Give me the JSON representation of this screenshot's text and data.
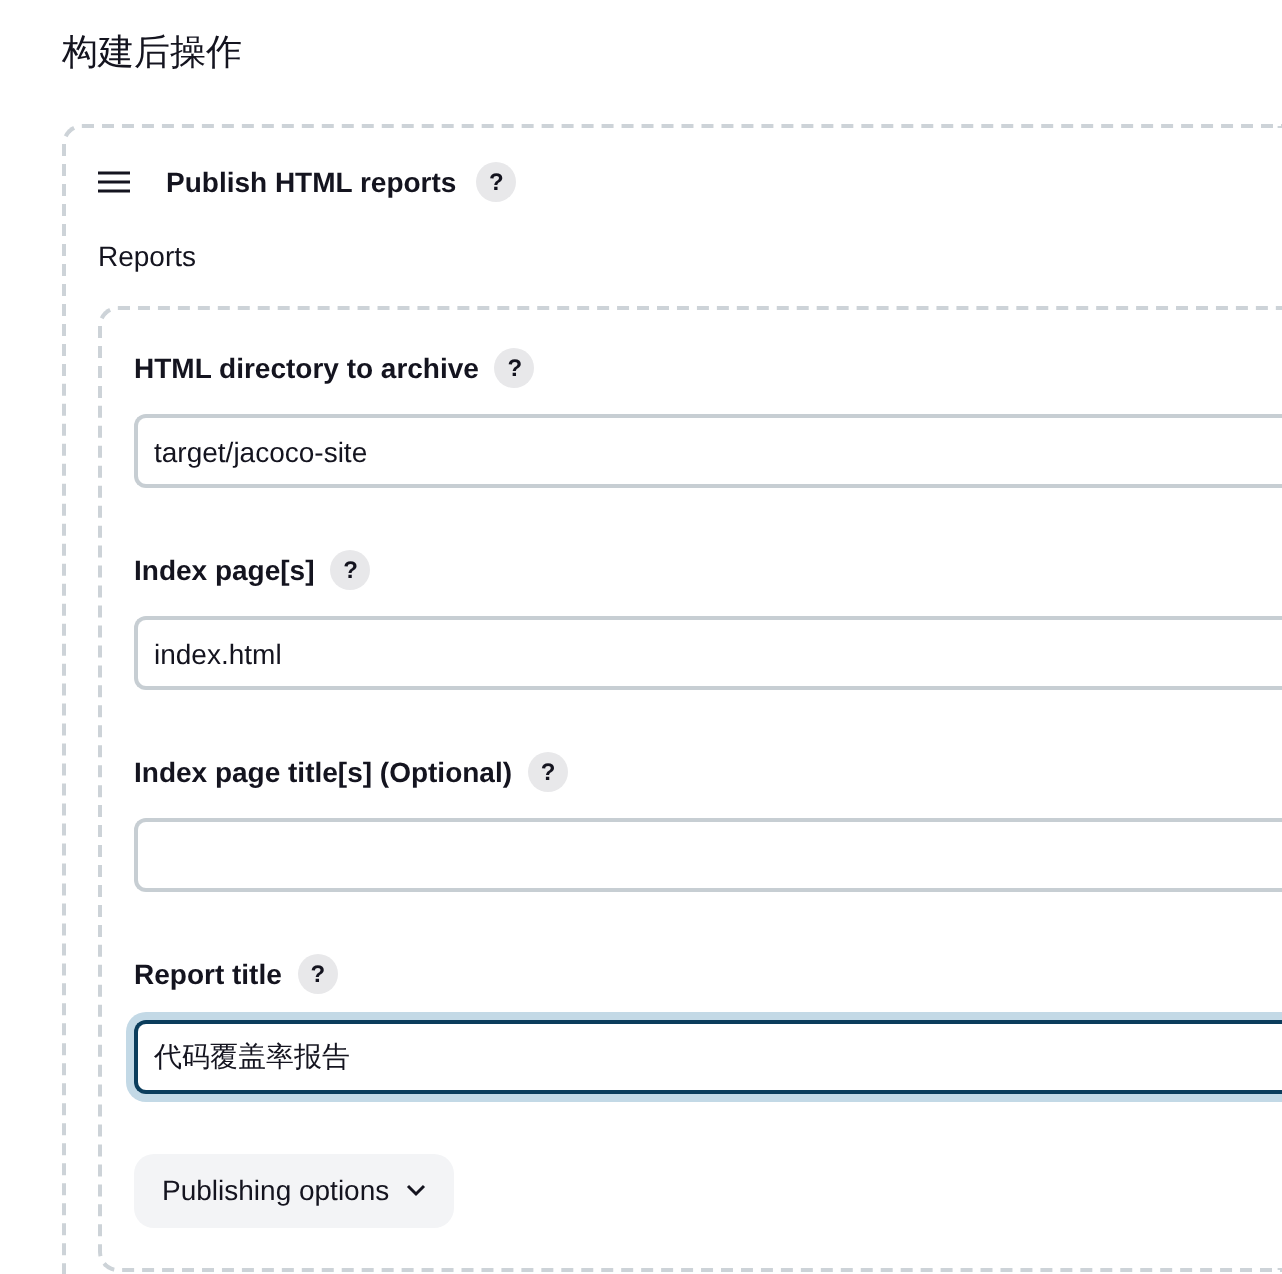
{
  "section_title": "构建后操作",
  "step": {
    "title": "Publish HTML reports",
    "help": "?",
    "subtitle": "Reports"
  },
  "fields": [
    {
      "label": "HTML directory to archive",
      "help": "?",
      "value": "target/jacoco-site",
      "focused": false
    },
    {
      "label": "Index page[s]",
      "help": "?",
      "value": "index.html",
      "focused": false
    },
    {
      "label": "Index page title[s] (Optional)",
      "help": "?",
      "focused": false
    },
    {
      "label": "Report title",
      "help": "?",
      "value": "代码覆盖率报告",
      "focused": true
    }
  ],
  "options_button": {
    "label": "Publishing options",
    "expanded": false
  }
}
